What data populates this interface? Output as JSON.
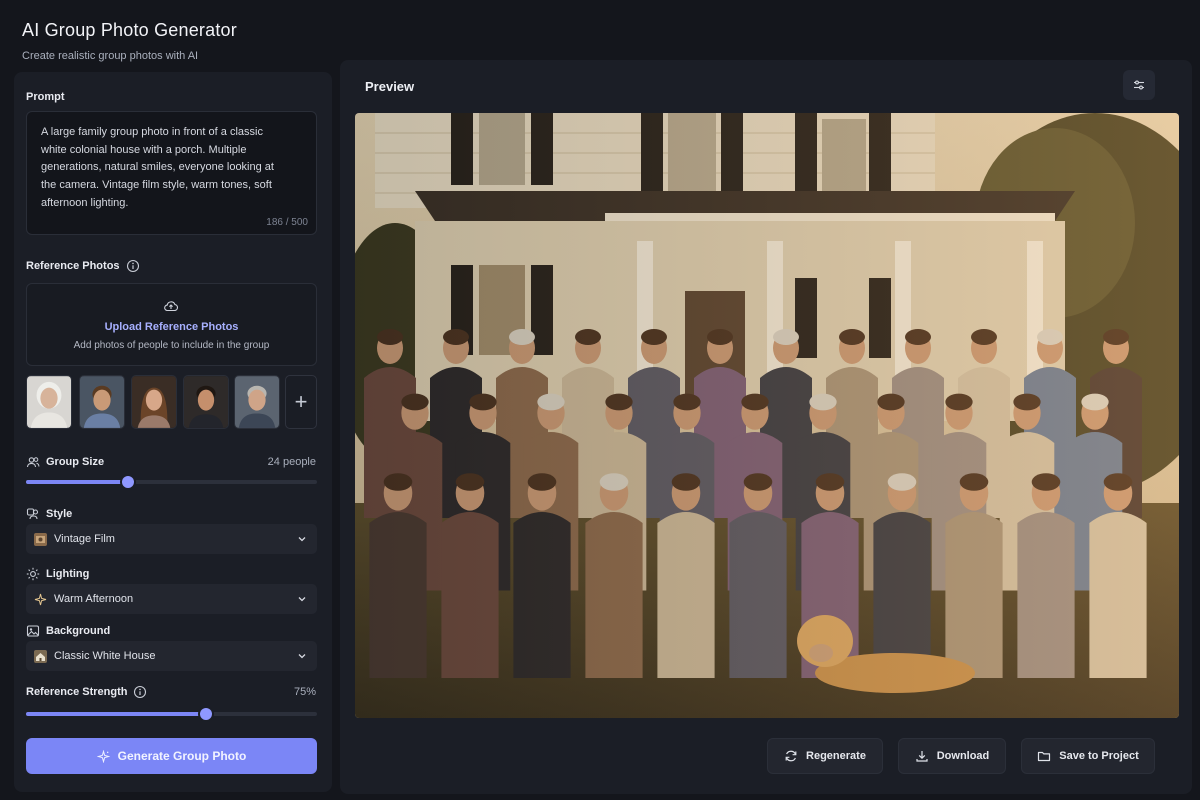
{
  "app": {
    "title": "AI Group Photo Generator",
    "subtitle": "Create realistic group photos with AI"
  },
  "prompt": {
    "label": "Prompt",
    "text": "A large family group photo in front of a classic white colonial house with a porch. Multiple generations, natural smiles, everyone looking at the camera. Vintage film style, warm tones, soft afternoon lighting.",
    "char_count": "186 / 500"
  },
  "reference": {
    "label": "Reference Photos",
    "upload_title": "Upload Reference Photos",
    "upload_subtitle": "Add photos of people to include in the group",
    "add_label": "+"
  },
  "group_size": {
    "label": "Group Size",
    "value_text": "24 people",
    "fraction": 0.35
  },
  "style": {
    "label": "Style",
    "selected": "Vintage Film"
  },
  "lighting": {
    "label": "Lighting",
    "selected": "Warm Afternoon"
  },
  "background": {
    "label": "Background",
    "selected": "Classic White House"
  },
  "strength": {
    "label": "Reference Strength",
    "value_text": "75%",
    "fraction": 0.62
  },
  "generate_button": "Generate Group Photo",
  "preview": {
    "title": "Preview"
  },
  "actions": {
    "regenerate": "Regenerate",
    "download": "Download",
    "save": "Save to Project"
  },
  "colors": {
    "accent": "#7b86f6",
    "background": "#14161c",
    "panel": "#1b1e26"
  }
}
